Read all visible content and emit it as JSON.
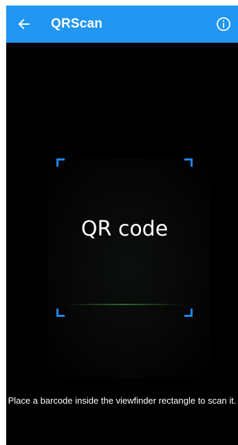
{
  "app_bar": {
    "title": "QRScan",
    "back_icon": "back-arrow-icon",
    "info_icon": "info-icon",
    "background_color": "#2196f3"
  },
  "viewfinder": {
    "placeholder_text": "QR code",
    "corner_color": "#1e88e5",
    "laser_color": "#4caf50"
  },
  "hint": {
    "text": "Place a barcode inside the viewfinder rectangle to scan it."
  }
}
